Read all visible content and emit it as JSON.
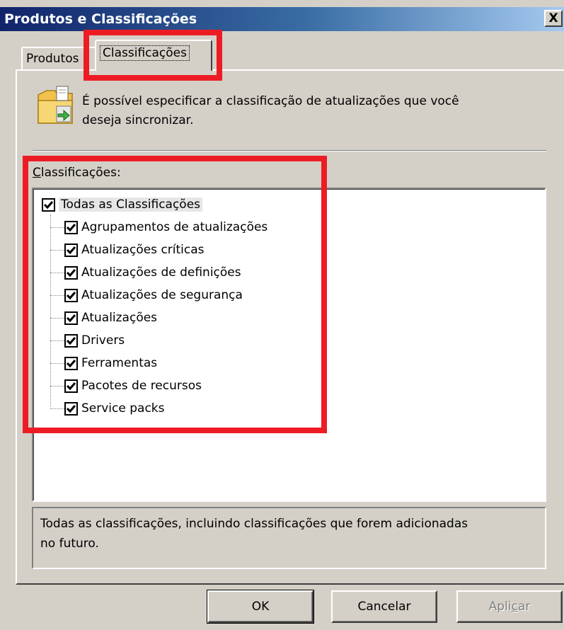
{
  "window": {
    "title": "Produtos e Classificações",
    "close_label": "X"
  },
  "tabs": [
    {
      "label": "Produtos",
      "selected": false
    },
    {
      "label": "Classificações",
      "selected": true
    }
  ],
  "info": {
    "text_line1": "É possível especificar a classificação de atualizações que você",
    "text_line2": "deseja sincronizar."
  },
  "list": {
    "label_accel": "C",
    "label_rest": "lassificações:",
    "root": {
      "label": "Todas as Classificações",
      "checked": true
    },
    "items": [
      {
        "label": "Agrupamentos de atualizações",
        "checked": true
      },
      {
        "label": "Atualizações críticas",
        "checked": true
      },
      {
        "label": "Atualizações de definições",
        "checked": true
      },
      {
        "label": "Atualizações de segurança",
        "checked": true
      },
      {
        "label": "Atualizações",
        "checked": true
      },
      {
        "label": "Drivers",
        "checked": true
      },
      {
        "label": "Ferramentas",
        "checked": true
      },
      {
        "label": "Pacotes de recursos",
        "checked": true
      },
      {
        "label": "Service packs",
        "checked": true
      }
    ]
  },
  "description": {
    "line1": "Todas as classificações, incluindo classificações que forem adicionadas",
    "line2": "no futuro."
  },
  "buttons": {
    "ok": "OK",
    "cancel": "Cancelar",
    "apply_accel_pre": "Apli",
    "apply_accel": "c",
    "apply_post": "ar"
  },
  "colors": {
    "highlight": "#ed1c24",
    "titlebar_start": "#10246a",
    "titlebar_end": "#a6caf0"
  },
  "icons": {
    "info": "folder-sync-icon",
    "close": "close-icon",
    "check": "checkmark-icon"
  }
}
